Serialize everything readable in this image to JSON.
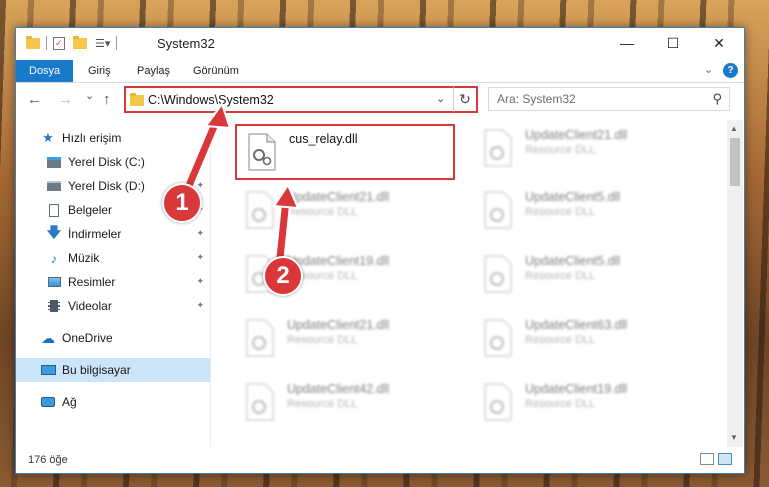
{
  "window": {
    "title": "System32",
    "minimize_label": "—",
    "maximize_label": "☐",
    "close_label": "✕"
  },
  "ribbon": {
    "tabs": [
      {
        "label": "Dosya"
      },
      {
        "label": "Giriş"
      },
      {
        "label": "Paylaş"
      },
      {
        "label": "Görünüm"
      }
    ],
    "expand_icon": "chevron-down-icon",
    "help_label": "?"
  },
  "address": {
    "path": "C:\\Windows\\System32",
    "dropdown_glyph": "⌄",
    "refresh_glyph": "↻"
  },
  "search": {
    "placeholder": "Ara: System32",
    "icon_glyph": "⚲"
  },
  "nav": {
    "back_glyph": "←",
    "forward_glyph": "→",
    "recent_glyph": "⌄",
    "up_glyph": "↑",
    "items": [
      {
        "label": "Hızlı erişim",
        "icon": "star-icon",
        "pinned": false
      },
      {
        "label": "Yerel Disk (C:)",
        "icon": "drive-icon",
        "pinned": false
      },
      {
        "label": "Yerel Disk (D:)",
        "icon": "drive-icon",
        "pinned": true
      },
      {
        "label": "Belgeler",
        "icon": "documents-icon",
        "pinned": true
      },
      {
        "label": "İndirmeler",
        "icon": "download-icon",
        "pinned": true
      },
      {
        "label": "Müzik",
        "icon": "music-icon",
        "pinned": true
      },
      {
        "label": "Resimler",
        "icon": "pictures-icon",
        "pinned": true
      },
      {
        "label": "Videolar",
        "icon": "video-icon",
        "pinned": true
      },
      {
        "label": "OneDrive",
        "icon": "cloud-icon",
        "pinned": false
      },
      {
        "label": "Bu bilgisayar",
        "icon": "computer-icon",
        "pinned": false
      },
      {
        "label": "Ağ",
        "icon": "network-icon",
        "pinned": false
      }
    ],
    "pin_glyph": "📌"
  },
  "files": {
    "selected": {
      "name": "cus_relay.dll",
      "type": ""
    },
    "col1": [
      {
        "name": "UpdateClient21.dll",
        "type": "Resource DLL"
      },
      {
        "name": "UpdateClient19.dll",
        "type": "Resource DLL"
      },
      {
        "name": "UpdateClient21.dll",
        "type": "Resource DLL"
      },
      {
        "name": "UpdateClient42.dll",
        "type": "Resource DLL"
      }
    ],
    "col2": [
      {
        "name": "UpdateClient21.dll",
        "type": "Resource DLL"
      },
      {
        "name": "UpdateClient5.dll",
        "type": "Resource DLL"
      },
      {
        "name": "UpdateClient5.dll",
        "type": "Resource DLL"
      },
      {
        "name": "UpdateClient63.dll",
        "type": "Resource DLL"
      },
      {
        "name": "UpdateClient19.dll",
        "type": "Resource DLL"
      }
    ]
  },
  "status": {
    "count": "176 öğe"
  },
  "annotations": {
    "step1": "1",
    "step2": "2",
    "color": "#d9373a"
  }
}
